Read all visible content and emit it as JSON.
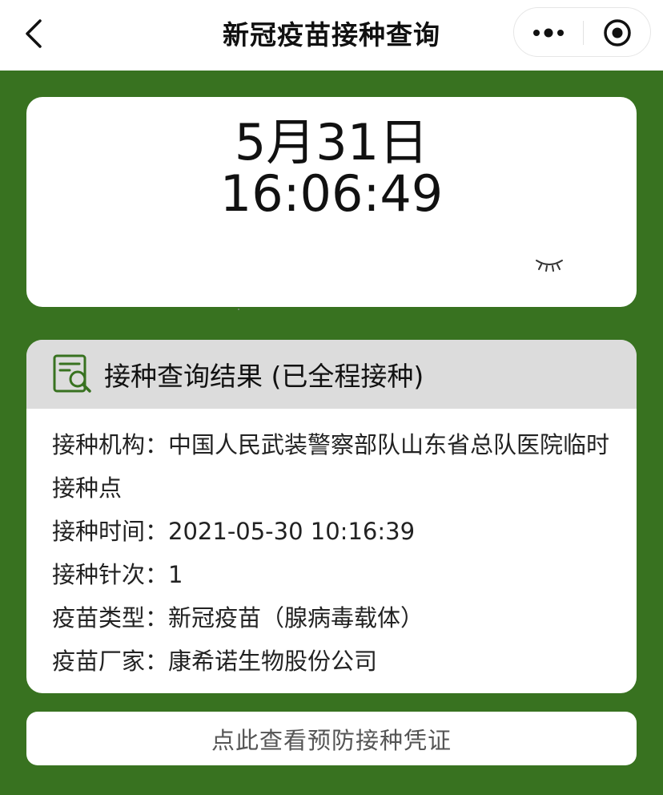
{
  "nav": {
    "title": "新冠疫苗接种查询",
    "back_icon": "chevron-left-icon",
    "more_icon": "more-dots-icon",
    "close_icon": "target-circle-icon"
  },
  "clock": {
    "date": "5月31日",
    "time": "16:06:49",
    "eye_icon": "eye-closed-icon"
  },
  "result": {
    "title": "接种查询结果 (已全程接种)",
    "icon": "document-search-icon",
    "rows": [
      {
        "label": "接种机构：",
        "value": "中国人民武装警察部队山东省总队医院临时接种点"
      },
      {
        "label": "接种时间：",
        "value": "2021-05-30 10:16:39"
      },
      {
        "label": "接种针次：",
        "value": "1"
      },
      {
        "label": "疫苗类型：",
        "value": "新冠疫苗（腺病毒载体）"
      },
      {
        "label": "疫苗厂家：",
        "value": "康希诺生物股份公司"
      }
    ]
  },
  "voucher_button": {
    "label": "点此查看预防接种凭证"
  },
  "colors": {
    "accent_green": "#387220",
    "header_gray": "#dcdcdc"
  }
}
